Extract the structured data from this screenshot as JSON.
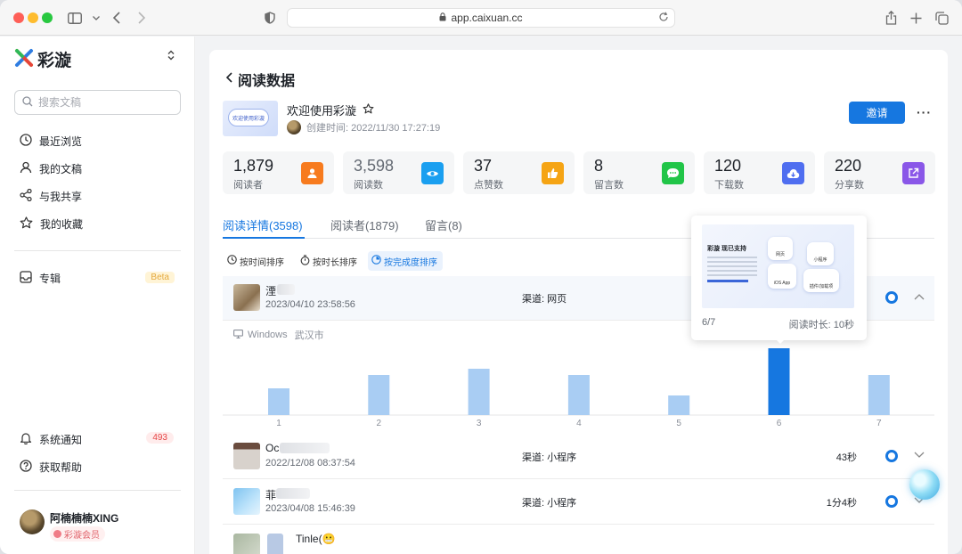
{
  "browser": {
    "url": "app.caixuan.cc"
  },
  "sidebar": {
    "logo_text": "彩漩",
    "search_placeholder": "搜索文稿",
    "items": [
      {
        "label": "最近浏览",
        "icon": "clock-icon"
      },
      {
        "label": "我的文稿",
        "icon": "person-icon"
      },
      {
        "label": "与我共享",
        "icon": "share-icon"
      },
      {
        "label": "我的收藏",
        "icon": "star-icon"
      }
    ],
    "album": {
      "label": "专辑",
      "badge": "Beta"
    },
    "notify": {
      "label": "系统通知",
      "count": "493"
    },
    "help": {
      "label": "获取帮助"
    },
    "user": {
      "name": "阿楠楠楠XING",
      "member": "彩漩会员"
    }
  },
  "page": {
    "title": "阅读数据",
    "doc_title": "欢迎使用彩漩",
    "doc_thumb_text": "欢迎使用彩漩",
    "created": "创建时间: 2022/11/30 17:27:19",
    "invite": "邀请",
    "more": "···"
  },
  "stats": [
    {
      "num": "1,879",
      "label": "阅读者",
      "color": "#f77b1e",
      "icon": "reader-icon"
    },
    {
      "num": "3,598",
      "label": "阅读数",
      "color": "#1a9ff0",
      "icon": "eye-icon"
    },
    {
      "num": "37",
      "label": "点赞数",
      "color": "#f5a414",
      "icon": "thumb-icon"
    },
    {
      "num": "8",
      "label": "留言数",
      "color": "#21c548",
      "icon": "comment-icon"
    },
    {
      "num": "120",
      "label": "下载数",
      "color": "#4f6ef0",
      "icon": "download-icon"
    },
    {
      "num": "220",
      "label": "分享数",
      "color": "#8a57e8",
      "icon": "external-icon"
    }
  ],
  "tabs": [
    "阅读详情(3598)",
    "阅读者(1879)",
    "留言(8)"
  ],
  "sorts": [
    "按时间排序",
    "按时长排序",
    "按完成度排序"
  ],
  "rows": [
    {
      "name": "湮",
      "time": "2023/04/10 23:58:56",
      "channel": "渠道: 网页",
      "duration": ""
    },
    {
      "name": "Oc",
      "time": "2022/12/08 08:37:54",
      "channel": "渠道: 小程序",
      "duration": "43秒"
    },
    {
      "name": "菲",
      "time": "2023/04/08 15:46:39",
      "channel": "渠道: 小程序",
      "duration": "1分4秒"
    },
    {
      "name": "Tinle(😬",
      "time": "",
      "channel": "",
      "duration": ""
    }
  ],
  "expanded": {
    "device": "Windows",
    "city": "武汉市"
  },
  "chart_data": {
    "type": "bar",
    "categories": [
      "1",
      "2",
      "3",
      "4",
      "5",
      "6",
      "7"
    ],
    "values": [
      30,
      45,
      52,
      45,
      22,
      75,
      45
    ],
    "highlight_index": 5,
    "colors": {
      "normal": "#a9cdf3",
      "highlight": "#1677e0"
    },
    "title": "",
    "xlabel": "",
    "ylabel": ""
  },
  "tooltip": {
    "page": "6/7",
    "read_time": "阅读时长: 10秒",
    "shot_title": "彩漩 现已支持",
    "shot_labels": [
      "网页",
      "小程序",
      "iOS App",
      "插件/加载项"
    ]
  }
}
